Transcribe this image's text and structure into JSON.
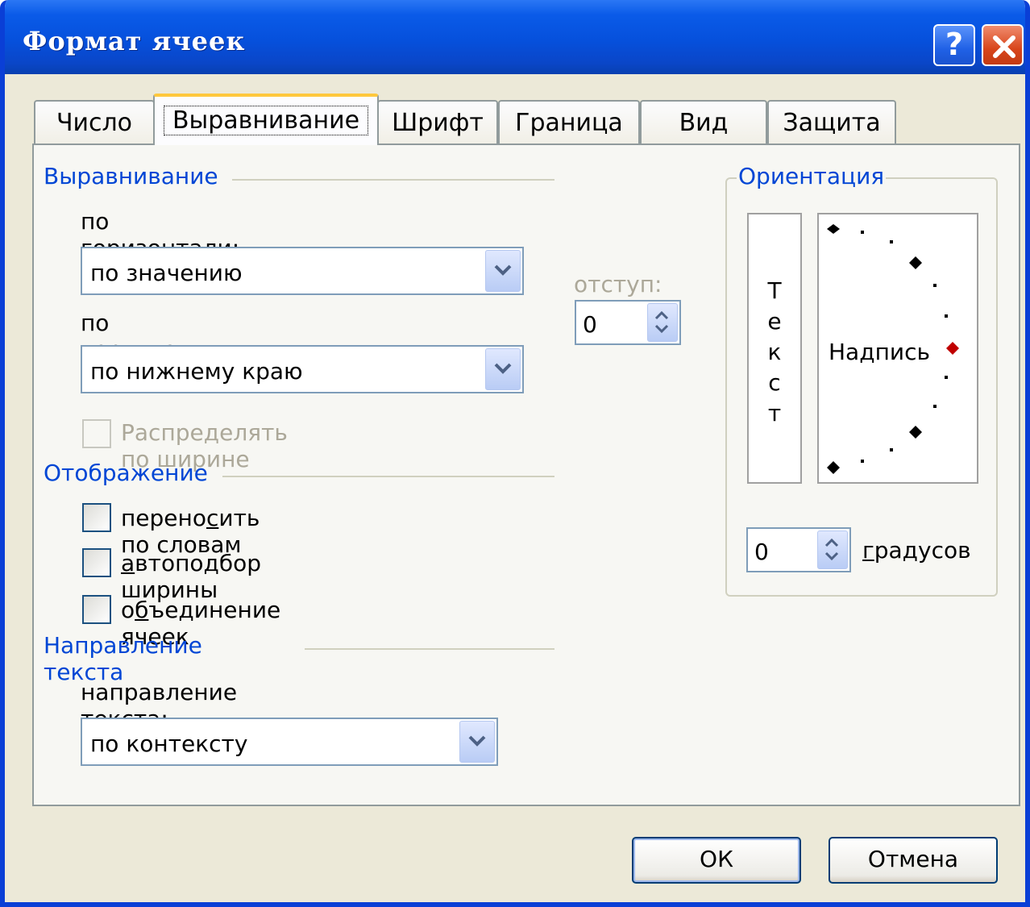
{
  "window": {
    "title": "Формат ячеек",
    "help_label": "?"
  },
  "tabs": [
    {
      "label": "Число"
    },
    {
      "label": "Выравнивание"
    },
    {
      "label": "Шрифт"
    },
    {
      "label": "Граница"
    },
    {
      "label": "Вид"
    },
    {
      "label": "Защита"
    }
  ],
  "alignment": {
    "group_title": "Выравнивание",
    "horizontal": {
      "label_pre": "по горизо",
      "label_accel": "н",
      "label_post": "тали:",
      "value": "по значению"
    },
    "vertical": {
      "label_pre": "по ",
      "label_accel": "в",
      "label_post": "ертикали:",
      "value": "по нижнему краю"
    },
    "indent": {
      "label": "отступ:",
      "value": "0"
    },
    "distribute": {
      "label": "Распределять по ширине",
      "checked": false,
      "enabled": false
    }
  },
  "display": {
    "group_title": "Отображение",
    "wrap": {
      "label_pre": "перено",
      "label_accel": "с",
      "label_post": "ить по словам",
      "checked": false
    },
    "shrink": {
      "label_pre": "",
      "label_accel": "а",
      "label_post": "втоподбор ширины",
      "checked": false
    },
    "merge": {
      "label_pre": "о",
      "label_accel": "б",
      "label_post": "ъединение ячеек",
      "checked": false
    }
  },
  "text_direction": {
    "group_title": "Направление текста",
    "label_pre": "направление ",
    "label_accel": "т",
    "label_post": "екста:",
    "value": "по контексту"
  },
  "orientation": {
    "group_title": "Ориентация",
    "vertical_letters": [
      "Т",
      "е",
      "к",
      "с",
      "т"
    ],
    "dial_label": "Надпись",
    "degrees_value": "0",
    "degrees_accel": "г",
    "degrees_post": "радусов",
    "handle_color": "#C00000"
  },
  "buttons": {
    "ok": "ОК",
    "cancel": "Отмена"
  },
  "colors": {
    "title_bar": "#0A5BE8",
    "group_title": "#0046D5",
    "dialog_bg": "#ECE9D8",
    "active_tab_accent": "#FFC83C"
  }
}
